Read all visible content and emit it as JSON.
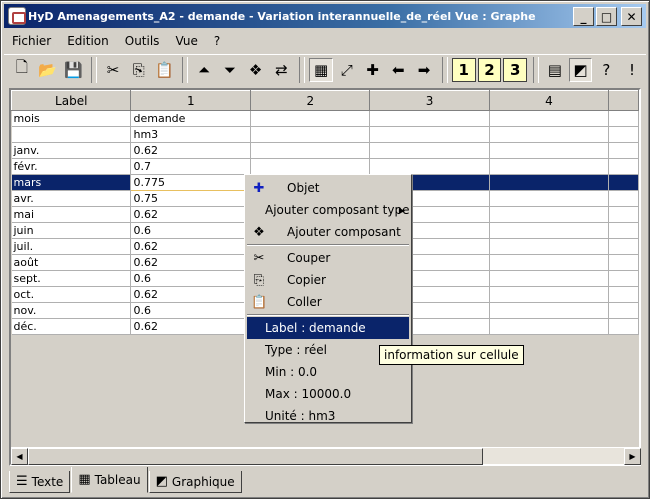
{
  "window": {
    "title": "HyD Amenagements_A2 - demande - Variation interannuelle_de_réel Vue  : Graphe",
    "min_glyph": "_",
    "max_glyph": "□",
    "close_glyph": "✕"
  },
  "menu": [
    "Fichier",
    "Edition",
    "Outils",
    "Vue",
    "?"
  ],
  "toolbar": {
    "new": "🗋",
    "open": "📂",
    "save": "💾",
    "cut": "✂",
    "copy": "⎘",
    "paste": "📋",
    "up": "⏶",
    "down": "⏷",
    "component": "❖",
    "link": "⇄",
    "chart": "▦",
    "fit": "⤢",
    "add": "✚",
    "left": "⬅",
    "right": "➡",
    "one": "1",
    "two": "2",
    "three": "3",
    "table": "▤",
    "graph": "◩",
    "help": "?",
    "info": "!"
  },
  "table": {
    "headers": [
      "Label",
      "1",
      "2",
      "3",
      "4"
    ],
    "rows": [
      [
        "mois",
        "demande"
      ],
      [
        "",
        "hm3"
      ],
      [
        "janv.",
        "0.62"
      ],
      [
        "févr.",
        "0.7"
      ],
      [
        "mars",
        "0.775"
      ],
      [
        "avr.",
        "0.75"
      ],
      [
        "mai",
        "0.62"
      ],
      [
        "juin",
        "0.6"
      ],
      [
        "juil.",
        "0.62"
      ],
      [
        "août",
        "0.62"
      ],
      [
        "sept.",
        "0.6"
      ],
      [
        "oct.",
        "0.62"
      ],
      [
        "nov.",
        "0.6"
      ],
      [
        "déc.",
        "0.62"
      ]
    ],
    "selected_row": 4
  },
  "context_menu": {
    "objet": "Objet",
    "ajouter_type": "Ajouter composant type",
    "ajouter": "Ajouter composant",
    "couper": "Couper",
    "copier": "Copier",
    "coller": "Coller",
    "label": "Label : demande",
    "type": "Type : réel",
    "min": "Min : 0.0",
    "max": "Max : 10000.0",
    "unite": "Unité : hm3"
  },
  "tooltip": "information sur cellule",
  "tabs": [
    "Texte",
    "Tableau",
    "Graphique"
  ],
  "icons": {
    "objet": "✚",
    "ajouter": "❖",
    "couper": "✂",
    "copier": "⎘",
    "coller": "📋",
    "texte": "☰",
    "tableau": "▦",
    "graphique": "◩",
    "submenu": "▶",
    "scroll_left": "◀",
    "scroll_right": "▶"
  },
  "colors": {
    "title_start": "#0a246a",
    "selection": "#0a246a",
    "tooltip_bg": "#ffffe1"
  }
}
